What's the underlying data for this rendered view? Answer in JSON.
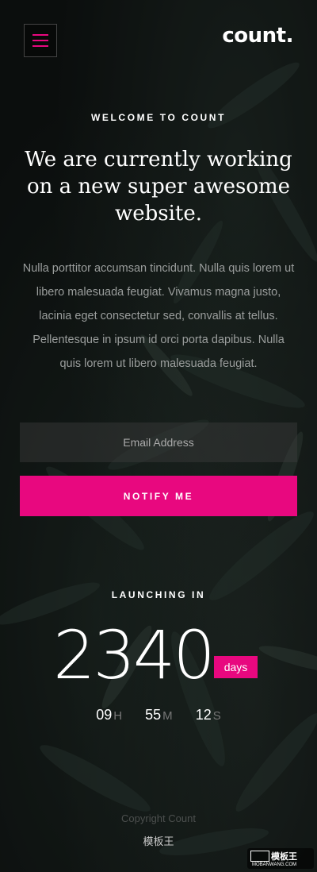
{
  "header": {
    "logo": "count."
  },
  "hero": {
    "welcome": "WELCOME TO COUNT",
    "headline": "We are currently working on a new super awesome website.",
    "description": "Nulla porttitor accumsan tincidunt. Nulla quis lorem ut libero malesuada feugiat. Vivamus magna justo, lacinia eget consectetur sed, convallis at tellus. Pellentesque in ipsum id orci porta dapibus. Nulla quis lorem ut libero malesuada feugiat."
  },
  "form": {
    "email_placeholder": "Email Address",
    "notify_label": "NOTIFY ME"
  },
  "countdown": {
    "label": "LAUNCHING IN",
    "days_value": "2340",
    "days_label": "days",
    "hours_value": "09",
    "hours_label": "H",
    "minutes_value": "55",
    "minutes_label": "M",
    "seconds_value": "12",
    "seconds_label": "S"
  },
  "footer": {
    "copyright": "Copyright Count",
    "brand": "模板王"
  },
  "watermark": {
    "text": "模板王",
    "url": "MOBANWANG.COM"
  },
  "colors": {
    "accent": "#e8087f",
    "background": "#0f1312"
  }
}
